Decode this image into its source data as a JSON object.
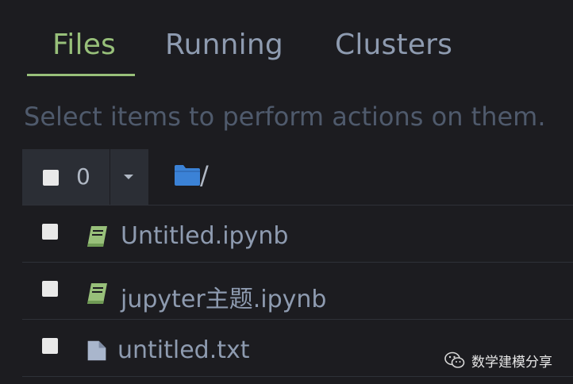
{
  "tabs": [
    {
      "label": "Files",
      "active": true
    },
    {
      "label": "Running",
      "active": false
    },
    {
      "label": "Clusters",
      "active": false
    }
  ],
  "hint_text": "Select items to perform actions on them.",
  "toolbar": {
    "selected_count": "0",
    "breadcrumb_separator": "/"
  },
  "files": [
    {
      "name": "Untitled.ipynb",
      "icon": "notebook-icon"
    },
    {
      "name": "jupyter主题.ipynb",
      "icon": "notebook-icon"
    },
    {
      "name": "untitled.txt",
      "icon": "file-icon"
    }
  ],
  "watermark": {
    "text": "数学建模分享"
  },
  "colors": {
    "background": "#1c1c20",
    "accent_green": "#98c07a",
    "tab_text": "#8e9bb0",
    "hint_text": "#4f5a6c",
    "folder_blue": "#3b82d6"
  }
}
